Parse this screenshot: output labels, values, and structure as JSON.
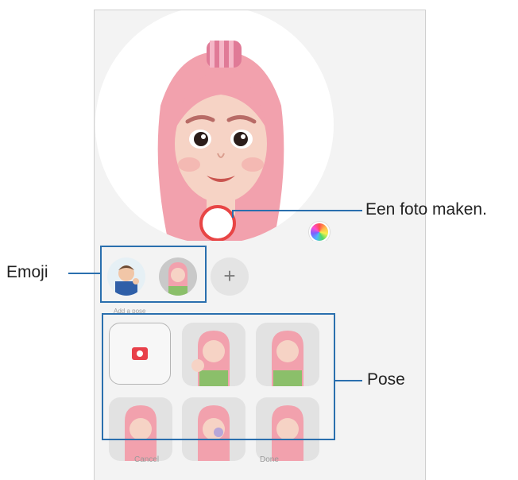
{
  "callouts": {
    "take_photo": "Een foto maken.",
    "emoji": "Emoji",
    "pose": "Pose"
  },
  "sheet": {
    "section_label": "Add a pose"
  },
  "footer": {
    "cancel_label": "Cancel",
    "done_label": "Done"
  },
  "add_symbol": "+",
  "colors": {
    "accent_line": "#2a6fae",
    "shutter_ring": "#e84545",
    "camera_icon": "#e8404a",
    "hair": "#f2a1ad"
  }
}
